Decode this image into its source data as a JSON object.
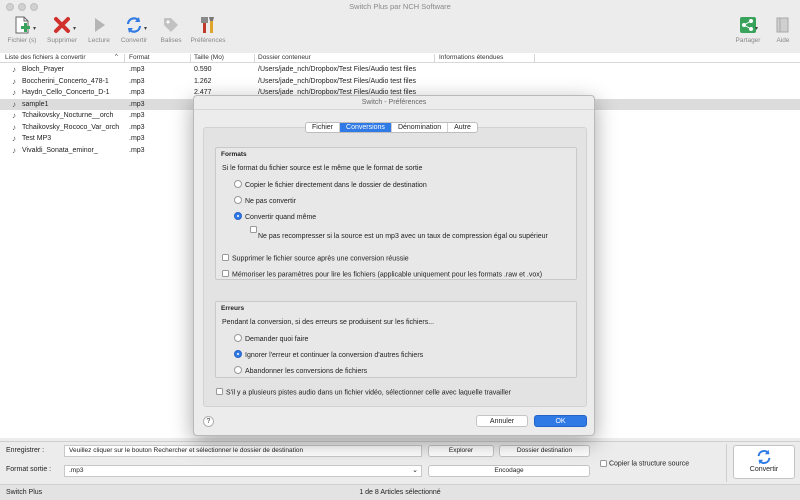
{
  "window": {
    "title": "Switch Plus par NCH Software"
  },
  "toolbar": {
    "file": "Fichier (s)",
    "delete": "Supprimer",
    "play": "Lecture",
    "convert": "Convertir",
    "tags": "Balises",
    "preferences": "Préférences",
    "share": "Partager",
    "help": "Aide"
  },
  "filelist": {
    "headers": {
      "name": "Liste des fichiers à convertir",
      "format": "Format",
      "size": "Taille (Mo)",
      "folder": "Dossier conteneur",
      "info": "Informations étendues"
    },
    "rows": [
      {
        "name": "Bloch_Prayer",
        "format": ".mp3",
        "size": "0.590",
        "folder": "/Users/jade_nch/Dropbox/Test Files/Audio test files"
      },
      {
        "name": "Boccherini_Concerto_478-1",
        "format": ".mp3",
        "size": "1.262",
        "folder": "/Users/jade_nch/Dropbox/Test Files/Audio test files"
      },
      {
        "name": "Haydn_Cello_Concerto_D-1",
        "format": ".mp3",
        "size": "2.477",
        "folder": "/Users/jade_nch/Dropbox/Test Files/Audio test files"
      },
      {
        "name": "sample1",
        "format": ".mp3",
        "size": "",
        "folder": ""
      },
      {
        "name": "Tchaikovsky_Nocturne__orch",
        "format": ".mp3",
        "size": "",
        "folder": ""
      },
      {
        "name": "Tchaikovsky_Rococo_Var_orch",
        "format": ".mp3",
        "size": "",
        "folder": ""
      },
      {
        "name": "Test MP3",
        "format": ".mp3",
        "size": "",
        "folder": ""
      },
      {
        "name": "Vivaldi_Sonata_eminor_",
        "format": ".mp3",
        "size": "",
        "folder": ""
      }
    ]
  },
  "bottom": {
    "save_label": "Enregistrer :",
    "save_value": "Veuillez cliquer sur le bouton Rechercher et sélectionner le dossier de destination",
    "browse": "Explorer",
    "dest_folder": "Dossier destination",
    "format_label": "Format sortie :",
    "format_value": ".mp3",
    "encoding": "Encodage",
    "copy_structure": "Copier la structure source",
    "convert": "Convertir"
  },
  "status": {
    "app": "Switch Plus",
    "selection": "1 de 8 Articles sélectionné"
  },
  "dialog": {
    "title": "Switch - Préférences",
    "tabs": [
      "Fichier",
      "Conversions",
      "Dénomination",
      "Autre"
    ],
    "formats_title": "Formats",
    "formats_question": "Si le format du fichier source est le même que le format de sortie",
    "opt_copy": "Copier le fichier directement dans le dossier de destination",
    "opt_noconvert": "Ne pas convertir",
    "opt_convert": "Convertir quand même",
    "opt_norecompress": "Ne pas recompresser si la source est un mp3 avec un taux de compression égal ou supérieur",
    "opt_delete_source": "Supprimer le fichier source après une conversion réussie",
    "opt_remember": "Mémoriser les paramètres pour lire les fichiers (applicable uniquement pour les formats .raw et .vox)",
    "errors_title": "Erreurs",
    "errors_question": "Pendant la conversion, si des erreurs se produisent sur les fichiers...",
    "err_ask": "Demander quoi faire",
    "err_ignore": "Ignorer l'erreur et continuer la conversion d'autres fichiers",
    "err_abort": "Abandonner les conversions de fichiers",
    "multi_track": "S'il y a plusieurs pistes audio dans un fichier vidéo, sélectionner celle avec laquelle travailler",
    "help": "?",
    "cancel": "Annuler",
    "ok": "OK"
  },
  "colors": {
    "accent": "#2f7ae5",
    "delete_red": "#d0312d",
    "share_green": "#3aa35b"
  }
}
